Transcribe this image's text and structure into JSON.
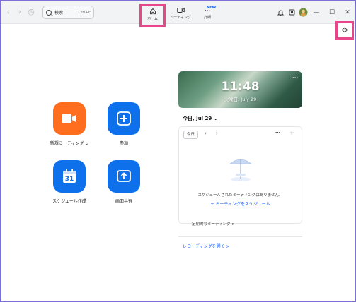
{
  "titlebar": {
    "search_placeholder": "検索",
    "search_shortcut": "Ctrl+F",
    "tabs": [
      {
        "label": "ホーム",
        "icon": "home-icon"
      },
      {
        "label": "ミーティング",
        "icon": "video-icon"
      },
      {
        "label": "詳細",
        "icon": "more-icon"
      }
    ],
    "new_badge": "NEW"
  },
  "actions": [
    {
      "label": "新規ミーティング",
      "icon": "video-camera-icon",
      "color": "#ff6d1f",
      "has_dropdown": true
    },
    {
      "label": "参加",
      "icon": "plus-icon",
      "color": "#0e71eb"
    },
    {
      "label": "スケジュール作成",
      "icon": "calendar-icon",
      "color": "#0e71eb",
      "calendar_day": "31"
    },
    {
      "label": "画面共有",
      "icon": "share-up-arrow-icon",
      "color": "#0e71eb"
    }
  ],
  "calendar": {
    "time": "11:48",
    "date": "火曜日, July 29",
    "date_heading": "今日, Jul 29",
    "today_button": "今日",
    "no_meetings": "スケジュールされたミーティングはありません。",
    "schedule_link": "+ ミーティングをスケジュール",
    "recurring_link": "定期的なミーティング >",
    "recordings_link": "レコーディングを開く >"
  },
  "colors": {
    "accent": "#0e71eb",
    "highlight": "#e8458b",
    "link": "#0b5cff"
  }
}
